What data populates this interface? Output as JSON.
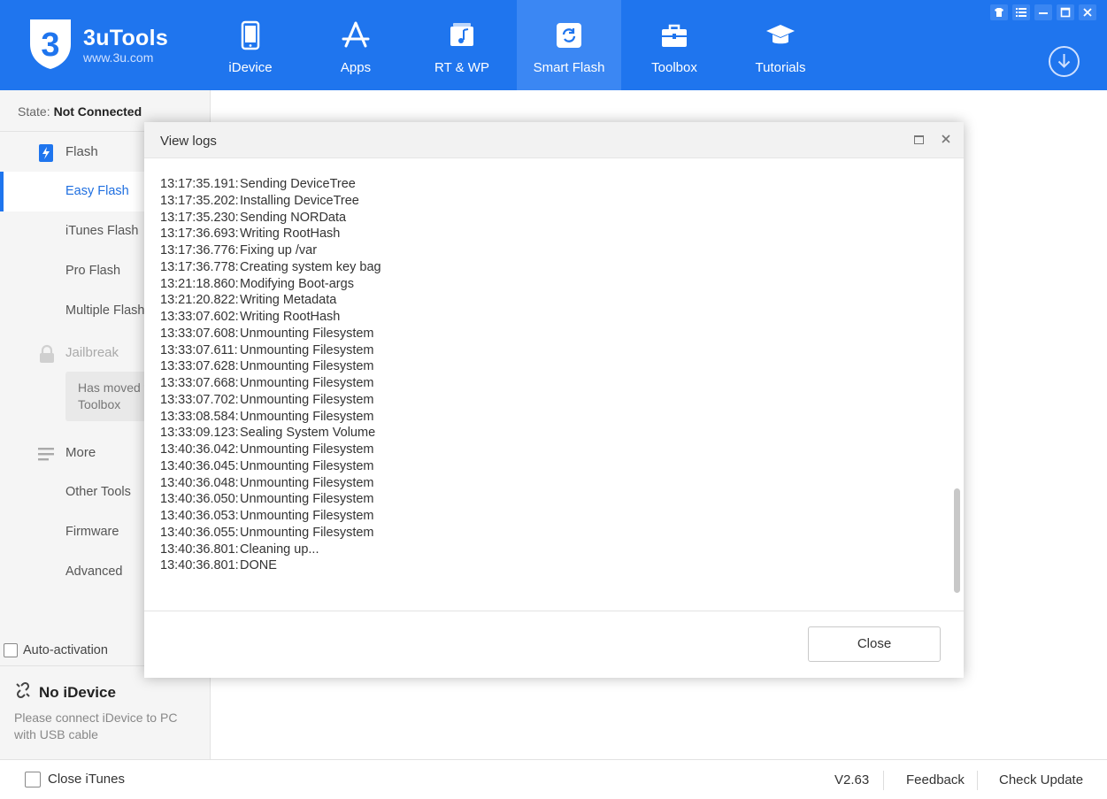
{
  "header": {
    "brand_name": "3uTools",
    "brand_url": "www.3u.com",
    "logo_text": "3",
    "accent": "#1f75ee",
    "nav": [
      {
        "label": "iDevice",
        "icon": "phone-icon"
      },
      {
        "label": "Apps",
        "icon": "app-store-icon"
      },
      {
        "label": "RT & WP",
        "icon": "music-icon"
      },
      {
        "label": "Smart Flash",
        "icon": "smart-flash-icon"
      },
      {
        "label": "Toolbox",
        "icon": "toolbox-icon"
      },
      {
        "label": "Tutorials",
        "icon": "graduation-cap-icon"
      }
    ],
    "active_tab": "Smart Flash"
  },
  "sidebar": {
    "state_label": "State:",
    "state_value": "Not Connected",
    "flash_section": "Flash",
    "flash_items": [
      "Easy Flash",
      "iTunes Flash",
      "Pro Flash",
      "Multiple Flash"
    ],
    "active_item": "Easy Flash",
    "jailbreak_section": "Jailbreak",
    "jailbreak_note": "Has moved to Toolbox",
    "more_section": "More",
    "more_items": [
      "Other Tools",
      "Firmware",
      "Advanced"
    ],
    "auto_activation_label": "Auto-activation",
    "no_device_title": "No iDevice",
    "no_device_desc": "Please connect iDevice to PC with USB cable"
  },
  "footer": {
    "close_itunes_label": "Close iTunes",
    "version": "V2.63",
    "feedback": "Feedback",
    "check_update": "Check Update"
  },
  "dialog": {
    "title": "View logs",
    "close_button": "Close",
    "logs": [
      {
        "ts": "13:17:35.191:",
        "msg": "Sending DeviceTree"
      },
      {
        "ts": "13:17:35.202:",
        "msg": "Installing DeviceTree"
      },
      {
        "ts": "13:17:35.230:",
        "msg": "Sending NORData"
      },
      {
        "ts": "13:17:36.693:",
        "msg": "Writing RootHash"
      },
      {
        "ts": "13:17:36.776:",
        "msg": "Fixing up /var"
      },
      {
        "ts": "13:17:36.778:",
        "msg": "Creating system key bag"
      },
      {
        "ts": "13:21:18.860:",
        "msg": "Modifying Boot-args"
      },
      {
        "ts": "13:21:20.822:",
        "msg": "Writing Metadata"
      },
      {
        "ts": "13:33:07.602:",
        "msg": "Writing RootHash"
      },
      {
        "ts": "13:33:07.608:",
        "msg": "Unmounting Filesystem"
      },
      {
        "ts": "13:33:07.611:",
        "msg": "Unmounting Filesystem"
      },
      {
        "ts": "13:33:07.628:",
        "msg": "Unmounting Filesystem"
      },
      {
        "ts": "13:33:07.668:",
        "msg": "Unmounting Filesystem"
      },
      {
        "ts": "13:33:07.702:",
        "msg": "Unmounting Filesystem"
      },
      {
        "ts": "13:33:08.584:",
        "msg": "Unmounting Filesystem"
      },
      {
        "ts": "13:33:09.123:",
        "msg": "Sealing System Volume"
      },
      {
        "ts": "13:40:36.042:",
        "msg": "Unmounting Filesystem"
      },
      {
        "ts": "13:40:36.045:",
        "msg": "Unmounting Filesystem"
      },
      {
        "ts": "13:40:36.048:",
        "msg": "Unmounting Filesystem"
      },
      {
        "ts": "13:40:36.050:",
        "msg": "Unmounting Filesystem"
      },
      {
        "ts": "13:40:36.053:",
        "msg": "Unmounting Filesystem"
      },
      {
        "ts": "13:40:36.055:",
        "msg": "Unmounting Filesystem"
      },
      {
        "ts": "13:40:36.801:",
        "msg": "Cleaning up..."
      },
      {
        "ts": "13:40:36.801:",
        "msg": "DONE"
      }
    ]
  }
}
